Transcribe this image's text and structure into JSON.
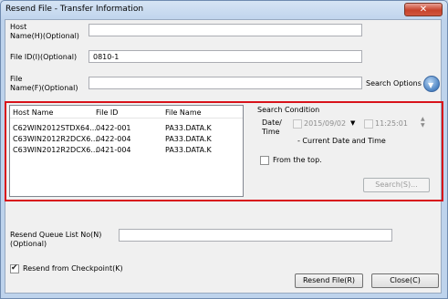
{
  "window": {
    "title": "Resend File - Transfer Information",
    "close_glyph": "✕"
  },
  "form": {
    "host_name_label": "Host\nName(H)(Optional)",
    "host_name_value": "",
    "file_id_label": "File ID(I)(Optional)",
    "file_id_value": "0810-1",
    "file_name_label": "File\nName(F)(Optional)",
    "file_name_value": "",
    "search_options_label": "Search Options",
    "search_options_icon": "chevron-down-icon"
  },
  "list": {
    "columns": [
      "Host Name",
      "File ID",
      "File Name"
    ],
    "rows": [
      [
        "C62WIN2012STDX64...",
        "0422-001",
        "PA33.DATA.K"
      ],
      [
        "C63WIN2012R2DCX6...",
        "0422-004",
        "PA33.DATA.K"
      ],
      [
        "C63WIN2012R2DCX6...",
        "0421-004",
        "PA33.DATA.K"
      ]
    ]
  },
  "search_condition": {
    "title": "Search Condition",
    "date_time_label": "Date/\nTime",
    "date_value": "2015/09/02",
    "time_value": "11:25:01",
    "current_note": "- Current Date and Time",
    "from_top_label": "From the top.",
    "search_button": "Search(S)..."
  },
  "queue": {
    "label": "Resend Queue List No(N)\n(Optional)",
    "value": ""
  },
  "checkpoint": {
    "label": "Resend from Checkpoint(K)",
    "checked": true
  },
  "buttons": {
    "resend": "Resend File(R)",
    "close": "Close(C)"
  },
  "colors": {
    "highlight_frame": "#d8121a",
    "title_bar": "#bed3ec"
  }
}
